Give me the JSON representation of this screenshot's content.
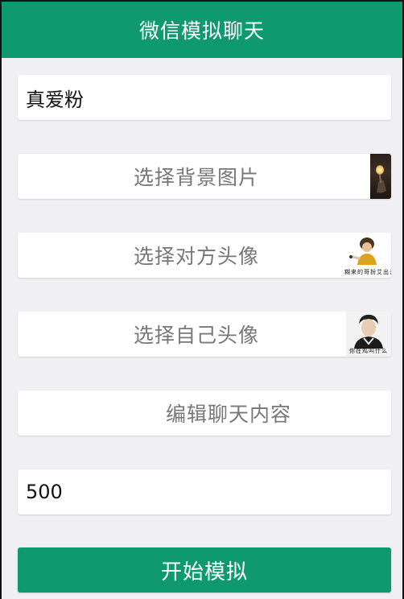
{
  "header": {
    "title": "微信模拟聊天"
  },
  "form": {
    "nickname_value": "真爱粉",
    "background_label": "选择背景图片",
    "peer_avatar_label": "选择对方头像",
    "peer_avatar_caption": "糊来的哥扮艾出去",
    "self_avatar_label": "选择自己头像",
    "self_avatar_caption": "你在鸡叫什么",
    "edit_chat_label": "编辑聊天内容",
    "count_value": "500"
  },
  "actions": {
    "start_label": "开始模拟"
  },
  "colors": {
    "brand_green": "#0f996e",
    "page_background": "#efeff4",
    "card_background": "#ffffff"
  }
}
